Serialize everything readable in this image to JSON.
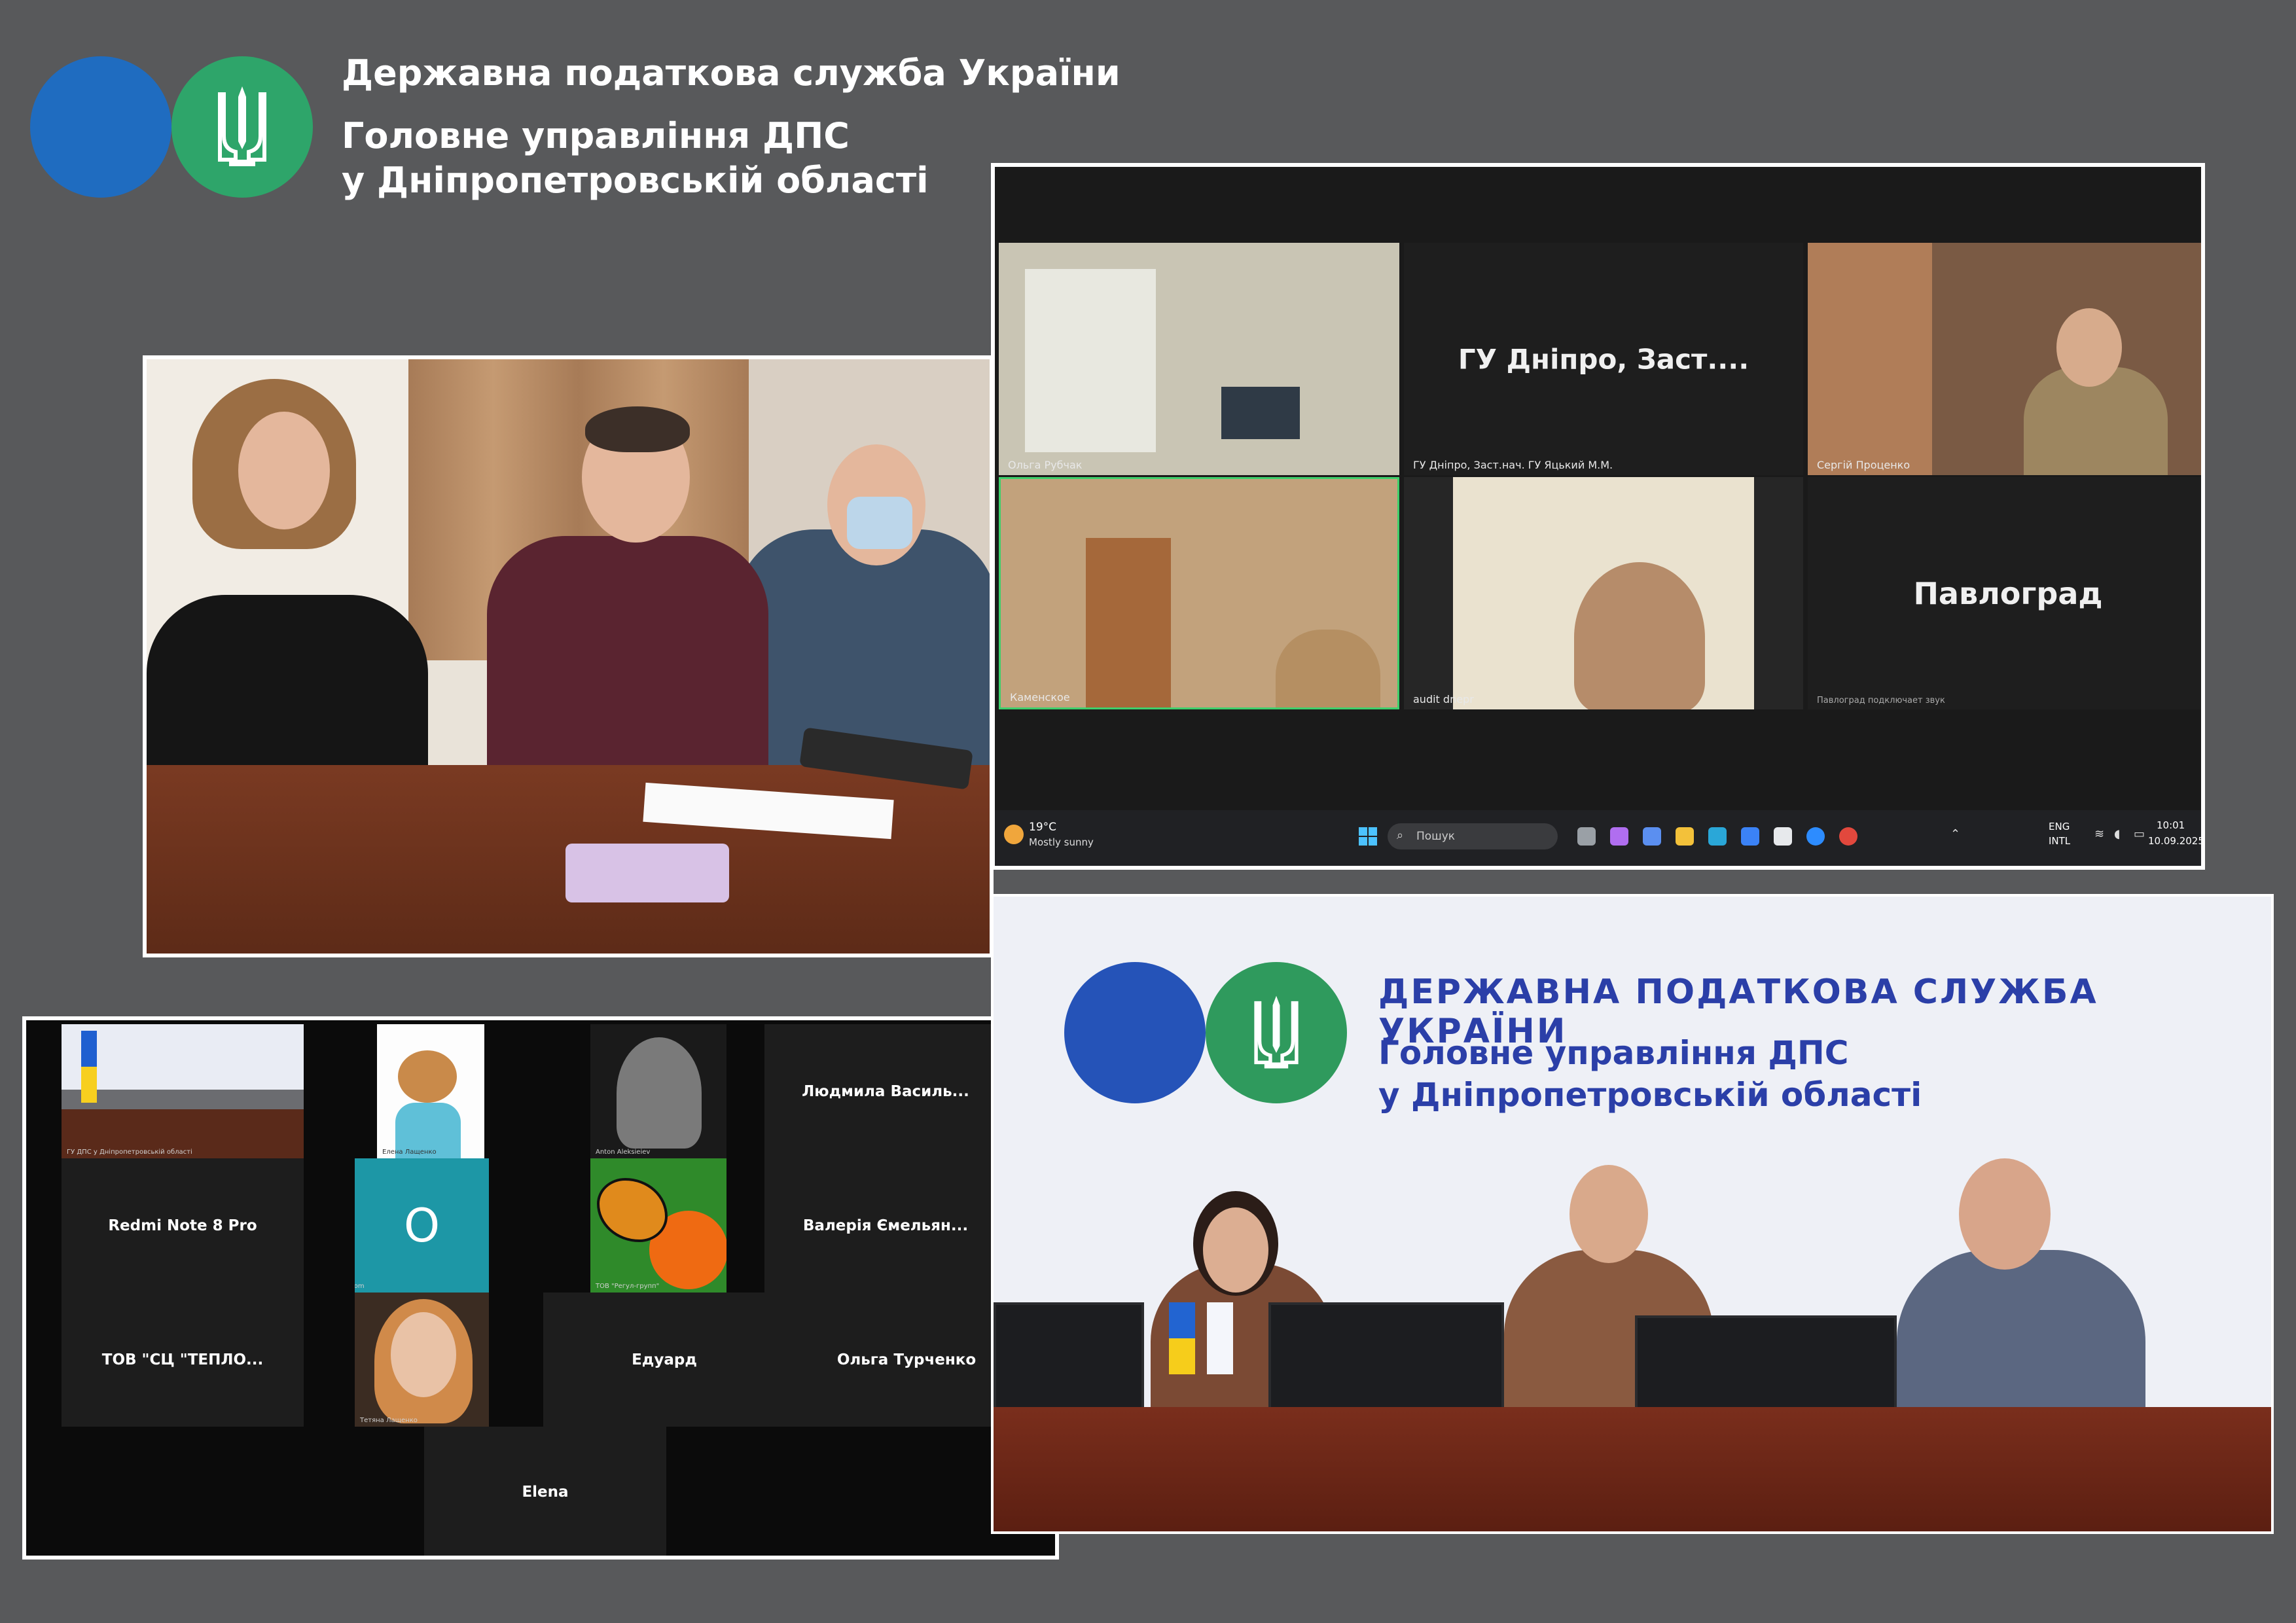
{
  "header": {
    "agency_name": "Державна податкова служба України",
    "department_line1": "Головне управління ДПС",
    "department_line2": "у Дніпропетровській області"
  },
  "photo_meeting": {},
  "zoom_screen": {
    "tiles": [
      {
        "label": "Ольга Рубчак"
      },
      {
        "center_text": "ГУ Дніпро, Заст....",
        "label": "ГУ Дніпро, Заст.нач. ГУ Яцький М.М."
      },
      {
        "label": "Сергій Проценко"
      },
      {
        "label": "Каменское"
      },
      {
        "label": "audit dnepr"
      },
      {
        "center_text": "Павлоград",
        "label": "Павлоград подключает звук"
      }
    ],
    "taskbar": {
      "weather_temp": "19°C",
      "weather_desc": "Mostly sunny",
      "search_placeholder": "Пошук",
      "lang_top": "ENG",
      "lang_bottom": "INTL",
      "time": "10:01",
      "date": "10.09.2025"
    }
  },
  "zoom_grid": {
    "tiles": [
      {
        "small_label": "ГУ ДПС у Дніпропетровській області"
      },
      {
        "small_label": "Елена Лащенко"
      },
      {
        "small_label": "Anton Aleksieiev"
      },
      {
        "name": "Людмила Василь..."
      },
      {
        "name": "Redmi Note 8 Pro"
      },
      {
        "initial": "O",
        "small_label": "work zoom"
      },
      {
        "small_label": "ТОВ \"Регул-групп\""
      },
      {
        "name": "Валерія Ємельян..."
      },
      {
        "name": "ТОВ \"СЦ \"ТЕПЛО..."
      },
      {
        "small_label": "Тетяна Лащенко"
      },
      {
        "name": "Едуард"
      },
      {
        "name": "Ольга Турченко"
      },
      {
        "name": "Elena"
      }
    ]
  },
  "photo_panel": {
    "wall_title": "ДЕРЖАВНА ПОДАТКОВА СЛУЖБА УКРАЇНИ",
    "wall_line1": "Головне управління ДПС",
    "wall_line2": "у Дніпропетровській області"
  },
  "colors": {
    "background": "#58595b",
    "logo_blue": "#1f6cc0",
    "logo_green": "#2ea56a",
    "panel_text": "#2b3fa8"
  }
}
